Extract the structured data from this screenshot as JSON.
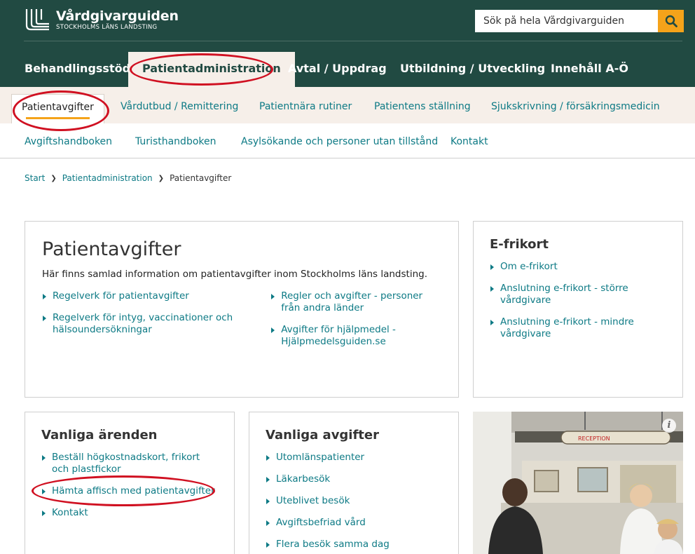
{
  "header": {
    "logo_title": "Vårdgivarguiden",
    "logo_subtitle": "STOCKHOLMS LÄNS LANDSTING",
    "search_placeholder": "Sök på hela Vårdgivarguiden",
    "colors": {
      "header_bg": "#214a42",
      "accent": "#f5a31a",
      "link": "#0d7a85",
      "subnav_bg": "#f6efe9",
      "annotation": "#d01021"
    }
  },
  "main_nav": [
    {
      "label": "Behandlingsstöd"
    },
    {
      "label": "Patientadministration"
    },
    {
      "label": "Avtal / Uppdrag"
    },
    {
      "label": "Utbildning / Utveckling"
    },
    {
      "label": "Innehåll A-Ö"
    }
  ],
  "sub_nav": [
    {
      "label": "Patientavgifter"
    },
    {
      "label": "Vårdutbud / Remittering"
    },
    {
      "label": "Patientnära rutiner"
    },
    {
      "label": "Patientens ställning"
    },
    {
      "label": "Sjukskrivning / försäkringsmedicin"
    }
  ],
  "third_nav": [
    {
      "label": "Avgiftshandboken"
    },
    {
      "label": "Turisthandboken"
    },
    {
      "label": "Asylsökande och personer utan tillstånd"
    },
    {
      "label": "Kontakt"
    }
  ],
  "breadcrumb": {
    "items": [
      "Start",
      "Patientadministration"
    ],
    "current": "Patientavgifter"
  },
  "main_panel": {
    "title": "Patientavgifter",
    "intro": "Här finns samlad information om patientavgifter inom Stockholms läns landsting.",
    "links_left": [
      "Regelverk för patientavgifter",
      "Regelverk för intyg, vaccinationer och hälsoundersökningar"
    ],
    "links_right": [
      "Regler och avgifter - personer från andra länder",
      "Avgifter för hjälpmedel - Hjälpmedelsguiden.se"
    ]
  },
  "efrikort_panel": {
    "title": "E-frikort",
    "links": [
      "Om e-frikort",
      "Anslutning e-frikort - större vårdgivare",
      "Anslutning e-frikort - mindre vårdgivare"
    ]
  },
  "common_matters": {
    "title": "Vanliga ärenden",
    "links": [
      "Beställ högkostnadskort, frikort och plastfickor",
      "Hämta affisch med patientavgifter",
      "Kontakt"
    ]
  },
  "common_fees": {
    "title": "Vanliga avgifter",
    "links": [
      "Utomlänspatienter",
      "Läkarbesök",
      "Uteblivet besök",
      "Avgiftsbefriad vård",
      "Flera besök samma dag"
    ]
  },
  "photo": {
    "sign_text": "RECEPTION",
    "info_icon": "info-icon"
  }
}
